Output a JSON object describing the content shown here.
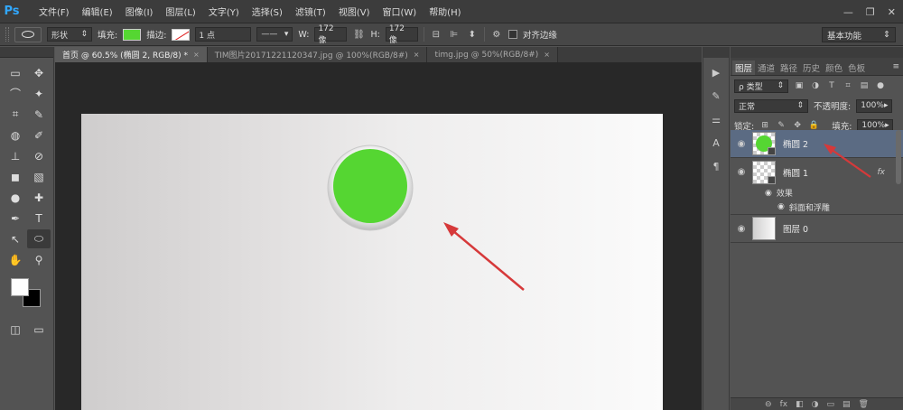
{
  "app": {
    "logo": "Ps"
  },
  "menu": [
    "文件(F)",
    "编辑(E)",
    "图像(I)",
    "图层(L)",
    "文字(Y)",
    "选择(S)",
    "滤镜(T)",
    "视图(V)",
    "窗口(W)",
    "帮助(H)"
  ],
  "window_controls": {
    "minimize": "—",
    "restore": "❐",
    "close": "✕"
  },
  "options": {
    "mode": "形状",
    "fill_label": "填充:",
    "stroke_label": "描边:",
    "stroke_width": "1 点",
    "w_label": "W:",
    "w_value": "172 像",
    "h_label": "H:",
    "h_value": "172 像",
    "align_edges": "对齐边缘",
    "workspace": "基本功能",
    "fill_color": "#55d632"
  },
  "tabs": [
    {
      "label": "首页 @ 60.5% (椭圆 2, RGB/8) *",
      "close": "×"
    },
    {
      "label": "TIM图片20171221120347.jpg @ 100%(RGB/8#)",
      "close": "×"
    },
    {
      "label": "timg.jpg @ 50%(RGB/8#)",
      "close": "×"
    }
  ],
  "tools": [
    "▭",
    "✥",
    "⌒",
    "✦",
    "⌗",
    "✎",
    "◍",
    "✐",
    "⊥",
    "⊘",
    "◼",
    "▧",
    "●",
    "✚",
    "✒",
    "T",
    "↖",
    "⬭",
    "✋",
    "⚲"
  ],
  "panel": {
    "tabs": [
      "图层",
      "通道",
      "路径",
      "历史",
      "颜色",
      "色板"
    ],
    "menu_icon": "≡",
    "filter_kind": "ρ 类型",
    "blend_mode": "正常",
    "opacity_label": "不透明度:",
    "opacity_value": "100%",
    "lock_label": "锁定:",
    "fill_label": "填充:",
    "fill_value": "100%"
  },
  "layers": [
    {
      "name": "椭圆 2",
      "selected": true
    },
    {
      "name": "椭圆 1",
      "fx": "fx"
    },
    {
      "name": "图层 0"
    }
  ],
  "effects": {
    "title": "效果",
    "item": "斜面和浮雕"
  },
  "footer_icons": [
    "⊖",
    "fx",
    "◧",
    "◑",
    "▭",
    "▤",
    "🗑"
  ]
}
